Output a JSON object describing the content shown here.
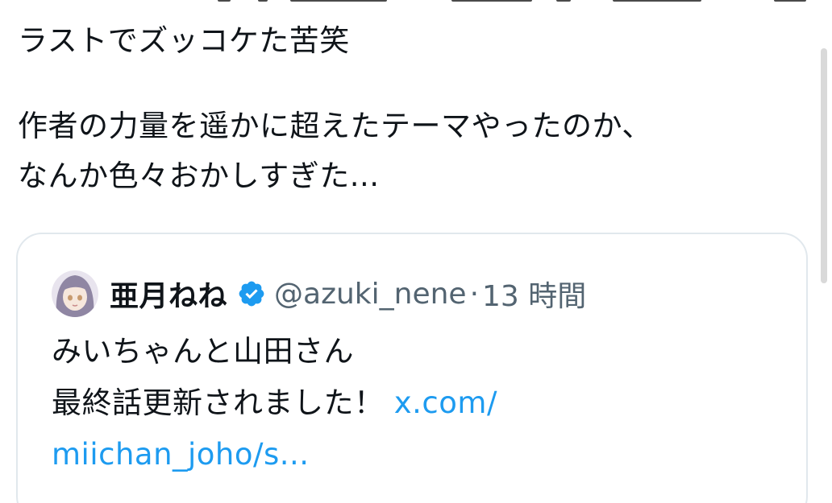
{
  "tweet": {
    "lines": [
      "ラストでズッコケた苦笑",
      "作者の力量を遥かに超えたテーマやったのか、",
      "なんか色々おかしすぎた..."
    ]
  },
  "quote": {
    "display_name": "亜月ねね",
    "handle": "@azuki_nene",
    "separator": "·",
    "time": "13 時間",
    "body_line1": "みいちゃんと山田さん",
    "body_line2": "最終話更新されました！",
    "link_part1": "x.com/",
    "link_part2": "miichan_joho/s..."
  },
  "colors": {
    "text": "#0f1419",
    "secondary": "#536471",
    "link": "#1d9bf0",
    "verified": "#1d9bf0",
    "card_border": "#e1e8ed"
  },
  "icons": {
    "verified": "verified-badge-icon",
    "avatar": "avatar"
  }
}
